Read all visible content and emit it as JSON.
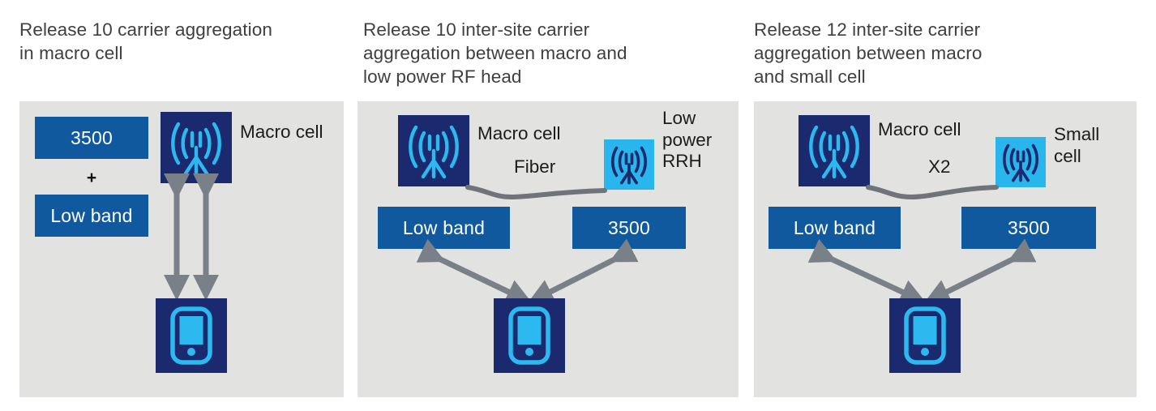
{
  "diagram": {
    "title_color": "#3f3f3f",
    "panel_bg": "#e2e2e0",
    "band_box_color": "#11599f",
    "macro_icon_bg": "#1b2a6e",
    "macro_icon_fg": "#2bb9ef",
    "small_icon_bg": "#29b6ec",
    "small_icon_fg": "#1b2a6e",
    "phone_bg": "#1b2a6e",
    "phone_fg": "#2bb9ef",
    "arrow_color": "#7a8087",
    "link_color": "#6e7479"
  },
  "panels": [
    {
      "title": "Release 10 carrier aggregation\nin macro cell",
      "boxes": [
        {
          "label": "3500"
        },
        {
          "label": "Low band"
        }
      ],
      "plus": "+",
      "nodes": [
        {
          "type": "macro-cell-icon",
          "caption": "Macro cell"
        },
        {
          "type": "phone-icon",
          "caption": ""
        }
      ],
      "links": [],
      "arrows": 2
    },
    {
      "title": "Release 10 inter-site carrier\naggregation between macro and\nlow power RF head",
      "boxes": [
        {
          "label": "Low band"
        },
        {
          "label": "3500"
        }
      ],
      "plus": "",
      "nodes": [
        {
          "type": "macro-cell-icon",
          "caption": "Macro cell"
        },
        {
          "type": "small-cell-icon",
          "caption": "Low\npower\nRRH"
        },
        {
          "type": "phone-icon",
          "caption": ""
        }
      ],
      "links": [
        {
          "label": "Fiber"
        }
      ],
      "arrows": 2
    },
    {
      "title": "Release 12 inter-site carrier\naggregation between macro\nand small cell",
      "boxes": [
        {
          "label": "Low band"
        },
        {
          "label": "3500"
        }
      ],
      "plus": "",
      "nodes": [
        {
          "type": "macro-cell-icon",
          "caption": "Macro cell"
        },
        {
          "type": "small-cell-icon",
          "caption": "Small\ncell"
        },
        {
          "type": "phone-icon",
          "caption": ""
        }
      ],
      "links": [
        {
          "label": "X2"
        }
      ],
      "arrows": 2
    }
  ]
}
